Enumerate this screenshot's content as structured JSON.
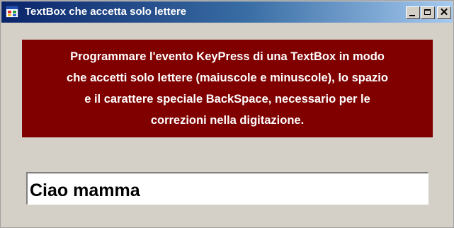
{
  "window": {
    "title": "TextBox che accetta solo lettere",
    "icon": "form-icon",
    "controls": {
      "minimize": "minimize-icon",
      "maximize": "maximize-icon",
      "close": "close-icon",
      "close_glyph": "✕"
    }
  },
  "instructions": {
    "text": "Programmare l'evento KeyPress di una TextBox in modo\nche accetti solo lettere (maiuscole e minuscole), lo spazio\ne il carattere speciale BackSpace, necessario per le\ncorrezioni nella digitazione."
  },
  "textbox": {
    "value": "Ciao mamma"
  },
  "colors": {
    "banner": "#800000",
    "background": "#d4d0c8"
  }
}
